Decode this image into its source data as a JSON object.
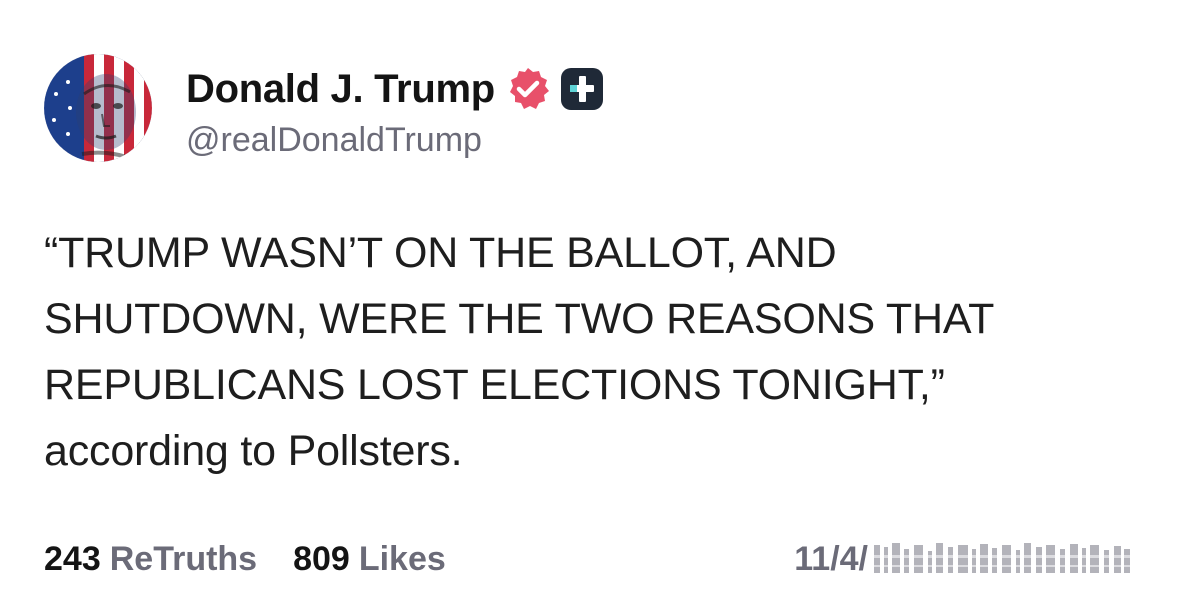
{
  "author": {
    "display_name": "Donald J. Trump",
    "handle": "@realDonaldTrump",
    "avatar_icon": "profile-avatar-flag-face",
    "verified_icon": "verified-check-icon",
    "plus_icon": "truth-plus-icon"
  },
  "post": {
    "lines": [
      "“TRUMP WASN’T ON THE BALLOT, AND",
      "SHUTDOWN, WERE THE TWO REASONS THAT",
      "REPUBLICANS LOST ELECTIONS TONIGHT,”",
      "according to Pollsters."
    ]
  },
  "stats": {
    "retruths_count": "243",
    "retruths_label": "ReTruths",
    "likes_count": "809",
    "likes_label": "Likes"
  },
  "timestamp": "11/4/",
  "colors": {
    "text": "#141414",
    "muted": "#6b6b78",
    "verified": "#e8506a",
    "plus_badge": "#1f2937",
    "plus_accent": "#5fd3d6"
  }
}
